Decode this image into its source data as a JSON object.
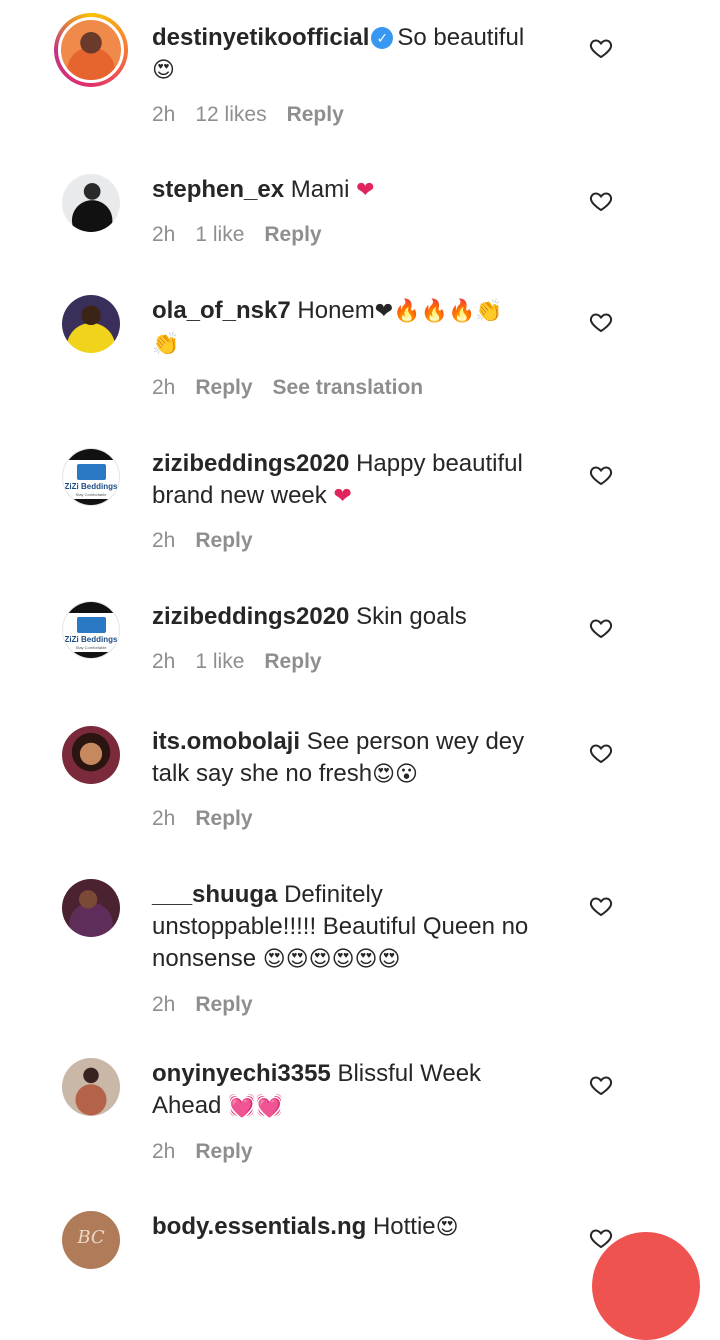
{
  "comments": [
    {
      "username": "destinyetikoofficial",
      "verified": true,
      "text": "So beautiful",
      "emoji": "😍",
      "time": "2h",
      "likes": "12 likes",
      "reply": "Reply"
    },
    {
      "username": "stephen_ex",
      "text": "Mami",
      "emoji": "❤",
      "time": "2h",
      "likes": "1 like",
      "reply": "Reply"
    },
    {
      "username": "ola_of_nsk7",
      "text": "Honem",
      "emoji": "❤🔥🔥🔥👏",
      "emoji2": "👏",
      "time": "2h",
      "reply": "Reply",
      "translate": "See translation"
    },
    {
      "username": "zizibeddings2020",
      "text": "Happy beautiful",
      "text2": "brand new week",
      "emoji": "❤",
      "time": "2h",
      "reply": "Reply",
      "avatar_title": "ZiZi Beddings",
      "avatar_sub": "Stay Comfortable"
    },
    {
      "username": "zizibeddings2020",
      "text": "Skin goals",
      "time": "2h",
      "likes": "1 like",
      "reply": "Reply",
      "avatar_title": "ZiZi Beddings",
      "avatar_sub": "Stay Comfortable"
    },
    {
      "username": "its.omobolaji",
      "text": "See person wey dey",
      "text2": "talk say she no fresh",
      "emoji": "😍😮",
      "time": "2h",
      "reply": "Reply"
    },
    {
      "username": "___shuuga",
      "text": "Definitely",
      "text2": "unstoppable!!!!! Beautiful Queen no",
      "text3": "nonsense",
      "emoji": "😍😍😍😍😍😍",
      "time": "2h",
      "reply": "Reply"
    },
    {
      "username": "onyinyechi3355",
      "text": "Blissful Week",
      "text2": "Ahead",
      "emoji": "💓💓",
      "time": "2h",
      "reply": "Reply"
    },
    {
      "username": "body.essentials.ng",
      "text": "Hottie",
      "emoji": "😍",
      "avatar_mono": "BC"
    }
  ],
  "icons": {
    "like": "heart-outline-icon",
    "verified": "verified-badge-icon"
  },
  "colors": {
    "text": "#262626",
    "meta": "#8e8e8e",
    "verified": "#3897f0",
    "fab": "#ef5350"
  }
}
